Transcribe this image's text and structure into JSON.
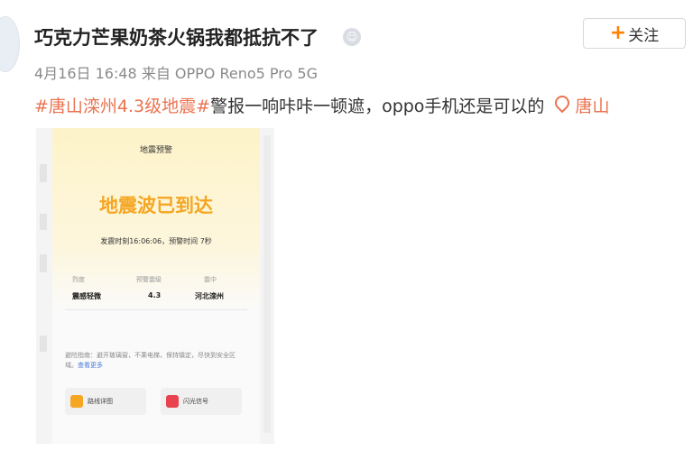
{
  "post": {
    "username": "巧克力芒果奶茶火锅我都抵抗不了",
    "badge_icon": "face-badge-icon",
    "follow_label": "关注",
    "meta": "4月16日 16:48 来自 OPPO Reno5 Pro 5G",
    "topic": "#唐山滦州4.3级地震#",
    "body": "警报一响咔咔一顿遮，oppo手机还是可以的",
    "location": "唐山",
    "accent_color": "#eb7350"
  },
  "alert": {
    "title": "地震预警",
    "main": "地震波已到达",
    "time_line": "发震时刻16:06:06，预警时间 7秒",
    "col1_label": "烈度",
    "col1_value": "震感轻微",
    "col2_label": "预警震级",
    "col2_value": "4.3",
    "col3_label": "震中",
    "col3_value": "河北滦州",
    "guide": "避险指南：避开玻璃窗，不乘电梯，保持镇定，尽快到安全区域。",
    "guide_more": "查看更多",
    "btn1": "路线详图",
    "btn2": "闪光信号"
  }
}
